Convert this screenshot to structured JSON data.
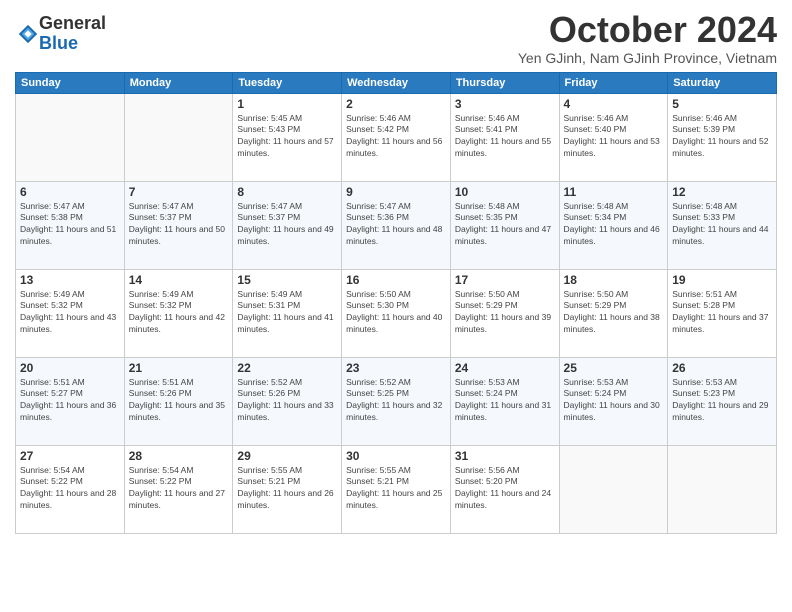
{
  "logo": {
    "general": "General",
    "blue": "Blue"
  },
  "title": "October 2024",
  "subtitle": "Yen GJinh, Nam GJinh Province, Vietnam",
  "headers": [
    "Sunday",
    "Monday",
    "Tuesday",
    "Wednesday",
    "Thursday",
    "Friday",
    "Saturday"
  ],
  "weeks": [
    [
      {
        "day": "",
        "info": ""
      },
      {
        "day": "",
        "info": ""
      },
      {
        "day": "1",
        "info": "Sunrise: 5:45 AM\nSunset: 5:43 PM\nDaylight: 11 hours and 57 minutes."
      },
      {
        "day": "2",
        "info": "Sunrise: 5:46 AM\nSunset: 5:42 PM\nDaylight: 11 hours and 56 minutes."
      },
      {
        "day": "3",
        "info": "Sunrise: 5:46 AM\nSunset: 5:41 PM\nDaylight: 11 hours and 55 minutes."
      },
      {
        "day": "4",
        "info": "Sunrise: 5:46 AM\nSunset: 5:40 PM\nDaylight: 11 hours and 53 minutes."
      },
      {
        "day": "5",
        "info": "Sunrise: 5:46 AM\nSunset: 5:39 PM\nDaylight: 11 hours and 52 minutes."
      }
    ],
    [
      {
        "day": "6",
        "info": "Sunrise: 5:47 AM\nSunset: 5:38 PM\nDaylight: 11 hours and 51 minutes."
      },
      {
        "day": "7",
        "info": "Sunrise: 5:47 AM\nSunset: 5:37 PM\nDaylight: 11 hours and 50 minutes."
      },
      {
        "day": "8",
        "info": "Sunrise: 5:47 AM\nSunset: 5:37 PM\nDaylight: 11 hours and 49 minutes."
      },
      {
        "day": "9",
        "info": "Sunrise: 5:47 AM\nSunset: 5:36 PM\nDaylight: 11 hours and 48 minutes."
      },
      {
        "day": "10",
        "info": "Sunrise: 5:48 AM\nSunset: 5:35 PM\nDaylight: 11 hours and 47 minutes."
      },
      {
        "day": "11",
        "info": "Sunrise: 5:48 AM\nSunset: 5:34 PM\nDaylight: 11 hours and 46 minutes."
      },
      {
        "day": "12",
        "info": "Sunrise: 5:48 AM\nSunset: 5:33 PM\nDaylight: 11 hours and 44 minutes."
      }
    ],
    [
      {
        "day": "13",
        "info": "Sunrise: 5:49 AM\nSunset: 5:32 PM\nDaylight: 11 hours and 43 minutes."
      },
      {
        "day": "14",
        "info": "Sunrise: 5:49 AM\nSunset: 5:32 PM\nDaylight: 11 hours and 42 minutes."
      },
      {
        "day": "15",
        "info": "Sunrise: 5:49 AM\nSunset: 5:31 PM\nDaylight: 11 hours and 41 minutes."
      },
      {
        "day": "16",
        "info": "Sunrise: 5:50 AM\nSunset: 5:30 PM\nDaylight: 11 hours and 40 minutes."
      },
      {
        "day": "17",
        "info": "Sunrise: 5:50 AM\nSunset: 5:29 PM\nDaylight: 11 hours and 39 minutes."
      },
      {
        "day": "18",
        "info": "Sunrise: 5:50 AM\nSunset: 5:29 PM\nDaylight: 11 hours and 38 minutes."
      },
      {
        "day": "19",
        "info": "Sunrise: 5:51 AM\nSunset: 5:28 PM\nDaylight: 11 hours and 37 minutes."
      }
    ],
    [
      {
        "day": "20",
        "info": "Sunrise: 5:51 AM\nSunset: 5:27 PM\nDaylight: 11 hours and 36 minutes."
      },
      {
        "day": "21",
        "info": "Sunrise: 5:51 AM\nSunset: 5:26 PM\nDaylight: 11 hours and 35 minutes."
      },
      {
        "day": "22",
        "info": "Sunrise: 5:52 AM\nSunset: 5:26 PM\nDaylight: 11 hours and 33 minutes."
      },
      {
        "day": "23",
        "info": "Sunrise: 5:52 AM\nSunset: 5:25 PM\nDaylight: 11 hours and 32 minutes."
      },
      {
        "day": "24",
        "info": "Sunrise: 5:53 AM\nSunset: 5:24 PM\nDaylight: 11 hours and 31 minutes."
      },
      {
        "day": "25",
        "info": "Sunrise: 5:53 AM\nSunset: 5:24 PM\nDaylight: 11 hours and 30 minutes."
      },
      {
        "day": "26",
        "info": "Sunrise: 5:53 AM\nSunset: 5:23 PM\nDaylight: 11 hours and 29 minutes."
      }
    ],
    [
      {
        "day": "27",
        "info": "Sunrise: 5:54 AM\nSunset: 5:22 PM\nDaylight: 11 hours and 28 minutes."
      },
      {
        "day": "28",
        "info": "Sunrise: 5:54 AM\nSunset: 5:22 PM\nDaylight: 11 hours and 27 minutes."
      },
      {
        "day": "29",
        "info": "Sunrise: 5:55 AM\nSunset: 5:21 PM\nDaylight: 11 hours and 26 minutes."
      },
      {
        "day": "30",
        "info": "Sunrise: 5:55 AM\nSunset: 5:21 PM\nDaylight: 11 hours and 25 minutes."
      },
      {
        "day": "31",
        "info": "Sunrise: 5:56 AM\nSunset: 5:20 PM\nDaylight: 11 hours and 24 minutes."
      },
      {
        "day": "",
        "info": ""
      },
      {
        "day": "",
        "info": ""
      }
    ]
  ]
}
